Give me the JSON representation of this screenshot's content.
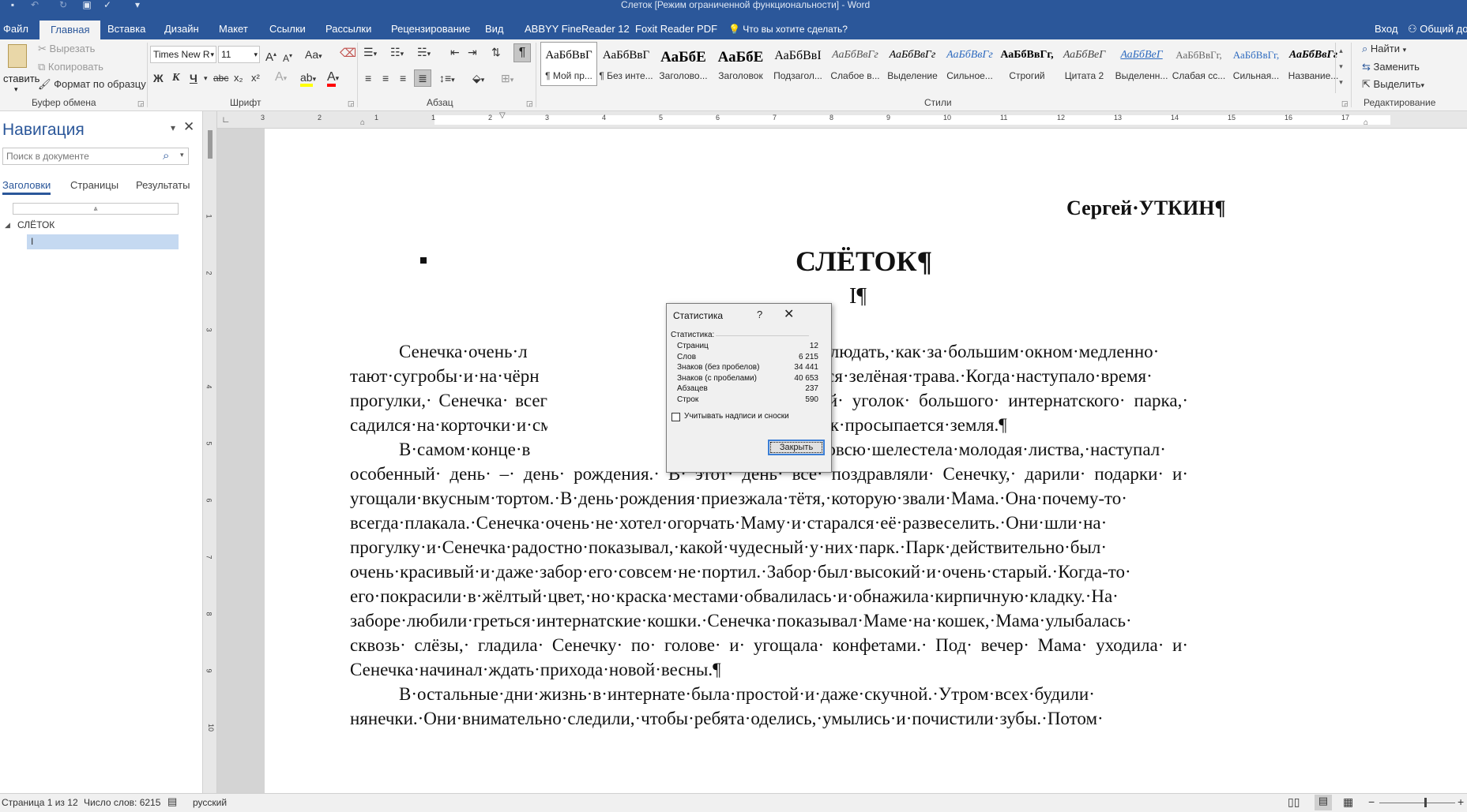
{
  "window": {
    "title": "Слеток [Режим ограниченной функциональности] - Word",
    "login": "Вход",
    "share": "Общий до"
  },
  "tabs": [
    "Файл",
    "Главная",
    "Вставка",
    "Дизайн",
    "Макет",
    "Ссылки",
    "Рассылки",
    "Рецензирование",
    "Вид",
    "ABBYY FineReader 12",
    "Foxit Reader PDF"
  ],
  "tell_me": "Что вы хотите сделать?",
  "clipboard": {
    "paste": "ставить",
    "cut": "Вырезать",
    "copy": "Копировать",
    "format_painter": "Формат по образцу",
    "label": "Буфер обмена"
  },
  "font": {
    "name": "Times New R",
    "size": "11",
    "label": "Шрифт",
    "bold": "Ж",
    "italic": "К",
    "underline": "Ч",
    "strike": "abc",
    "subscript": "x₂",
    "superscript": "x²",
    "grow": "A",
    "shrink": "A",
    "case": "Aa",
    "font_color_letter": "A",
    "effects_letter": "A"
  },
  "paragraph": {
    "label": "Абзац",
    "pilcrow": "¶"
  },
  "styles": {
    "label": "Стили",
    "items": [
      {
        "sample": "АаБбВвГ",
        "name": "¶ Мой пр..."
      },
      {
        "sample": "АаБбВвГ",
        "name": "¶ Без инте..."
      },
      {
        "sample": "АаБбЕ",
        "name": "Заголово..."
      },
      {
        "sample": "АаБбЕ",
        "name": "Заголовок"
      },
      {
        "sample": "АаБбВвІ",
        "name": "Подзагол..."
      },
      {
        "sample": "АаБбВвГг",
        "name": "Слабое в..."
      },
      {
        "sample": "АаБбВвГг",
        "name": "Выделение"
      },
      {
        "sample": "АаБбВвГг",
        "name": "Сильное..."
      },
      {
        "sample": "АаБбВвГг,",
        "name": "Строгий"
      },
      {
        "sample": "АаБбВеГ",
        "name": "Цитата 2"
      },
      {
        "sample": "АаБбВеГ",
        "name": "Выделенн..."
      },
      {
        "sample": "АаБбВвГг,",
        "name": "Слабая сс..."
      },
      {
        "sample": "АаБбВвГг,",
        "name": "Сильная..."
      },
      {
        "sample": "АаБбВвГг",
        "name": "Название..."
      }
    ]
  },
  "editing": {
    "label": "Редактирование",
    "find": "Найти",
    "replace": "Заменить",
    "select": "Выделить"
  },
  "navigation": {
    "title": "Навигация",
    "search_placeholder": "Поиск в документе",
    "tabs": [
      "Заголовки",
      "Страницы",
      "Результаты"
    ],
    "tree": [
      "СЛЁТОК",
      "I"
    ]
  },
  "ruler": {
    "h_ticks": [
      "3",
      "2",
      "1",
      "1",
      "2",
      "3",
      "4",
      "5",
      "6",
      "7",
      "8",
      "9",
      "10",
      "11",
      "12",
      "13",
      "14",
      "15",
      "16",
      "17"
    ],
    "v_ticks": [
      "1",
      "2",
      "3",
      "4",
      "5",
      "6",
      "7",
      "8",
      "9",
      "10"
    ]
  },
  "document": {
    "author": "Сергей·УТКИН¶",
    "title": "СЛЁТОК¶",
    "chapter": "I¶",
    "lines": [
      "Сенечка·очень·л",
      "нравилось·наблюдать,·как·за·большим·окном·медленно·",
      "тают·сугробы·и·на·чёрн",
      "ает·пробиваться·зелёная·трава.·Когда·наступало·время·",
      "прогулки,· Сенечка· всег",
      "амый· дальний· уголок· большого· интернатского· парка,·",
      "садился·на·корточки·и·см",
      "ет·природа,·как·просыпается·земля.¶",
      "В·самом·конце·в",
      "еревьях·уже·вовсю·шелестела·молодая·листва,·наступал·",
      "особенный· день· –· день· рождения.· В· этот· день· все· поздравляли· Сенечку,· дарили· подарки· и·",
      "угощали·вкусным·тортом.·В·день·рождения·приезжала·тётя,·которую·звали·Мама.·Она·почему-то·",
      "всегда·плакала.·Сенечка·очень·не·хотел·огорчать·Маму·и·старался·её·развеселить.·Они·шли·на·",
      "прогулку·и·Сенечка·радостно·показывал,·какой·чудесный·у·них·парк.·Парк·действительно·был·",
      "очень·красивый·и·даже·забор·его·совсем·не·портил.·Забор·был·высокий·и·очень·старый.·Когда-то·",
      "его·покрасили·в·жёлтый·цвет,·но·краска·местами·обвалилась·и·обнажила·кирпичную·кладку.·На·",
      "заборе·любили·греться·интернатские·кошки.·Сенечка·показывал·Маме·на·кошек,·Мама·улыбалась·",
      "сквозь· слёзы,· гладила· Сенечку· по· голове· и· угощала· конфетами.· Под· вечер· Мама· уходила· и·",
      "Сенечка·начинал·ждать·прихода·новой·весны.¶",
      "В·остальные·дни·жизнь·в·интернате·была·простой·и·даже·скучной.·Утром·всех·будили·",
      "нянечки.·Они·внимательно·следили,·чтобы·ребята·оделись,·умылись·и·почистили·зубы.·Потом·"
    ]
  },
  "dialog": {
    "title": "Статистика",
    "help": "?",
    "section": "Статистика:",
    "rows": [
      {
        "label": "Страниц",
        "value": "12"
      },
      {
        "label": "Слов",
        "value": "6 215"
      },
      {
        "label": "Знаков (без пробелов)",
        "value": "34 441"
      },
      {
        "label": "Знаков (с пробелами)",
        "value": "40 653"
      },
      {
        "label": "Абзацев",
        "value": "237"
      },
      {
        "label": "Строк",
        "value": "590"
      }
    ],
    "checkbox_label": "Учитывать надписи и сноски",
    "close_button": "Закрыть"
  },
  "status": {
    "page": "Страница 1 из 12",
    "words": "Число слов: 6215",
    "language": "русский"
  },
  "colors": {
    "accent": "#2b579a",
    "ribbon_bg": "#f3f3f3",
    "nav_selected": "#c5d9f1"
  }
}
